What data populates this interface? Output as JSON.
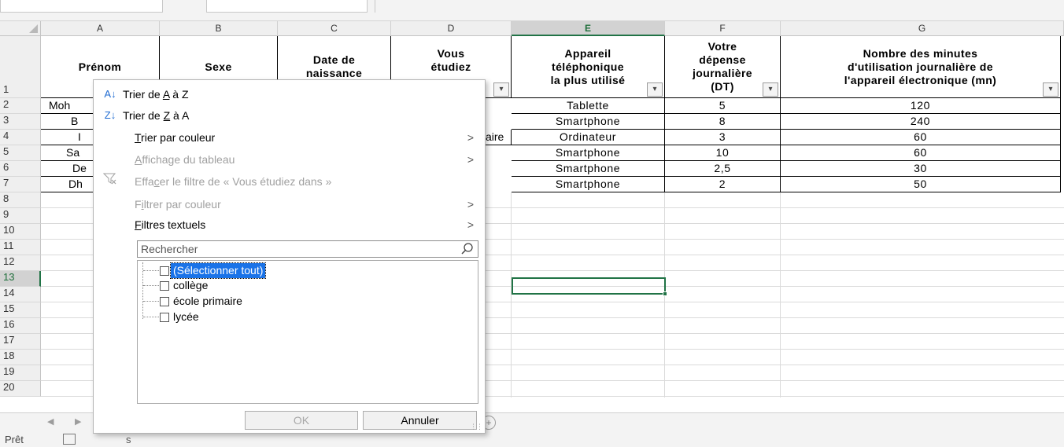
{
  "columns": [
    "A",
    "B",
    "C",
    "D",
    "E",
    "F",
    "G"
  ],
  "rows": [
    "1",
    "2",
    "3",
    "4",
    "5",
    "6",
    "7",
    "8",
    "9",
    "10",
    "11",
    "12",
    "13",
    "14",
    "15",
    "16",
    "17",
    "18",
    "19",
    "20"
  ],
  "headers": {
    "A": "Prénom",
    "B": "Sexe",
    "C": "Date de\nnaissance",
    "D": "Vous\nétudiez\n...",
    "E": "Appareil\ntéléphonique\nla plus utilisé",
    "F": "Votre\ndépense\njournalière\n(DT)",
    "G": "Nombre des minutes\nd'utilisation journalière de\nl'appareil électronique (mn)"
  },
  "visible_fragments": {
    "a2": "Moh",
    "a3": "B",
    "a4": "I",
    "a5": "Sa",
    "a6": "De",
    "a7": "Dh",
    "d4": "aire"
  },
  "data_rows": [
    {
      "E": "Tablette",
      "F": "5",
      "G": "120"
    },
    {
      "E": "Smartphone",
      "F": "8",
      "G": "240"
    },
    {
      "E": "Ordinateur",
      "F": "3",
      "G": "60"
    },
    {
      "E": "Smartphone",
      "F": "10",
      "G": "60"
    },
    {
      "E": "Smartphone",
      "F": "2,5",
      "G": "30"
    },
    {
      "E": "Smartphone",
      "F": "2",
      "G": "50"
    }
  ],
  "filter_menu": {
    "sort_az": {
      "pre": "Trier de ",
      "u": "A",
      "post": " à Z"
    },
    "sort_za": {
      "pre": "Trier de ",
      "u": "Z",
      "post": " à A"
    },
    "sort_color": {
      "u": "T",
      "post": "rier par couleur"
    },
    "table_view": {
      "u": "A",
      "post": "ffichage du tableau"
    },
    "clear_filter": {
      "pre": "Effa",
      "u": "c",
      "post": "er le filtre de « Vous étudiez dans »"
    },
    "filter_color": {
      "pre": "F",
      "u": "i",
      "post": "ltrer par couleur"
    },
    "text_filters": {
      "u": "F",
      "post": "iltres textuels"
    },
    "search_placeholder": "Rechercher",
    "list_items": [
      {
        "label": "(Sélectionner tout)",
        "checked": false
      },
      {
        "label": "collège",
        "checked": false
      },
      {
        "label": "école primaire",
        "checked": false
      },
      {
        "label": "lycée",
        "checked": false
      }
    ],
    "ok_label": "OK",
    "cancel_label": "Annuler"
  },
  "status": {
    "ready": "Prêt",
    "accessibility_fragment": "s"
  },
  "colors": {
    "excel_green": "#217346",
    "selection_blue": "#1a73e8"
  }
}
